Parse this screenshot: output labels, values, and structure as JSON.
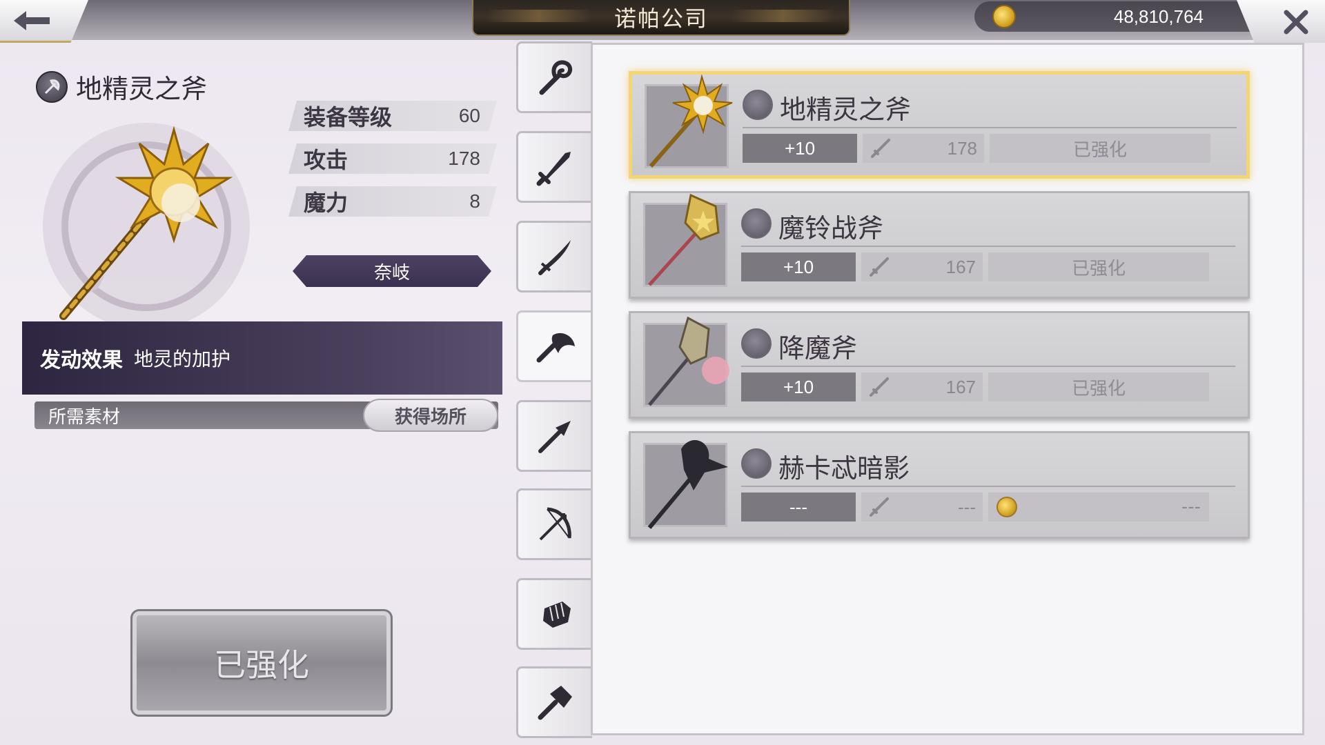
{
  "header": {
    "title": "诺帕公司",
    "gold": "48,810,764"
  },
  "detail": {
    "name": "地精灵之斧",
    "stats": [
      {
        "label": "装备等级",
        "value": "60"
      },
      {
        "label": "攻击",
        "value": "178"
      },
      {
        "label": "魔力",
        "value": "8"
      }
    ],
    "character": "奈岐",
    "effect_label": "发动效果",
    "effect_value": "地灵的加护",
    "materials_label": "所需素材",
    "source_label": "获得场所",
    "enhance_label": "已强化"
  },
  "tabs": [
    {
      "icon": "staff-icon"
    },
    {
      "icon": "sword-icon"
    },
    {
      "icon": "katana-icon"
    },
    {
      "icon": "axe-icon",
      "active": true
    },
    {
      "icon": "spear-icon"
    },
    {
      "icon": "bow-icon"
    },
    {
      "icon": "fist-icon"
    },
    {
      "icon": "hammer-icon"
    }
  ],
  "weapons": [
    {
      "name": "地精灵之斧",
      "plus": "+10",
      "attack": "178",
      "status": "已强化",
      "selected": true
    },
    {
      "name": "魔铃战斧",
      "plus": "+10",
      "attack": "167",
      "status": "已强化",
      "selected": false
    },
    {
      "name": "降魔斧",
      "plus": "+10",
      "attack": "167",
      "status": "已强化",
      "selected": false
    },
    {
      "name": "赫卡忒暗影",
      "plus": "---",
      "attack": "---",
      "status": "---",
      "selected": false
    }
  ]
}
